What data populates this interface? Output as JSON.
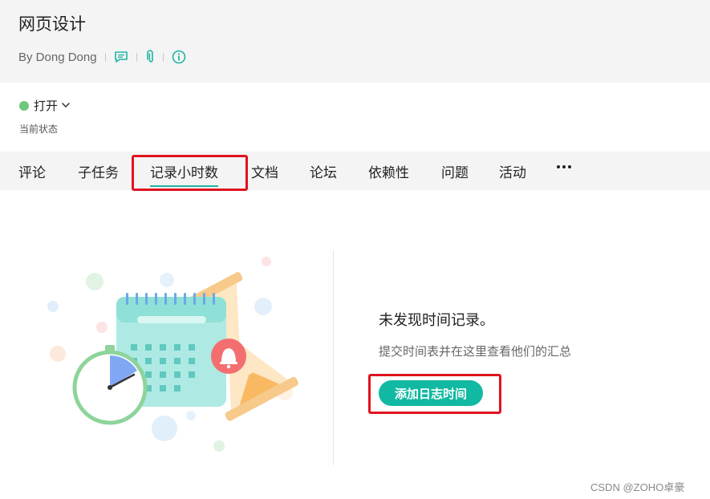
{
  "header": {
    "title": "网页设计",
    "author": "By Dong Dong",
    "icons": [
      "comment-icon",
      "attachment-icon",
      "info-icon"
    ],
    "accent": "#1fb5a2"
  },
  "status": {
    "value": "打开",
    "caption": "当前状态",
    "dot_color": "#6fc77a"
  },
  "tabs": [
    {
      "label": "评论"
    },
    {
      "label": "子任务"
    },
    {
      "label": "记录小时数",
      "active": true
    },
    {
      "label": "文档"
    },
    {
      "label": "论坛"
    },
    {
      "label": "依赖性"
    },
    {
      "label": "问题"
    },
    {
      "label": "活动"
    }
  ],
  "more_icon": "more-horizontal-icon",
  "empty_state": {
    "title": "未发现时间记录。",
    "subtitle": "提交时间表并在这里查看他们的汇总",
    "button_label": "添加日志时间",
    "button_color": "#11b9a2"
  },
  "highlight_color": "#e0131f",
  "watermark": "CSDN @ZOHO卓豪"
}
